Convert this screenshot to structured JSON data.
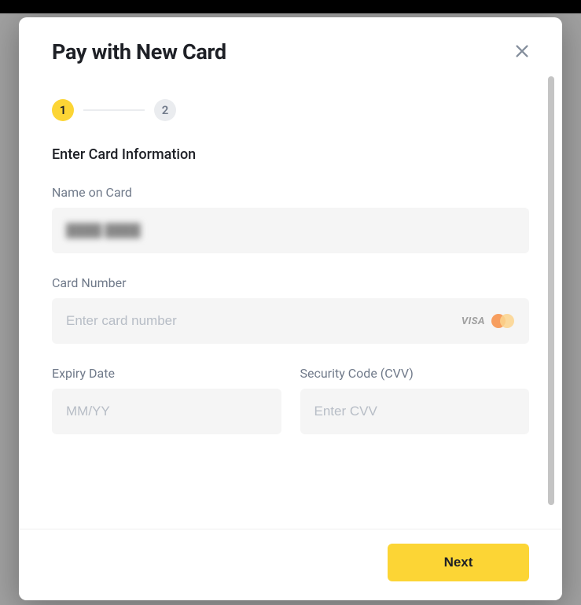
{
  "modal": {
    "title": "Pay with New Card",
    "section_title": "Enter Card Information",
    "next_button": "Next"
  },
  "stepper": {
    "step1": "1",
    "step2": "2"
  },
  "fields": {
    "name": {
      "label": "Name on Card",
      "blurred_value": "████ ████"
    },
    "card_number": {
      "label": "Card Number",
      "placeholder": "Enter card number",
      "visa_label": "VISA"
    },
    "expiry": {
      "label": "Expiry Date",
      "placeholder": "MM/YY"
    },
    "cvv": {
      "label": "Security Code (CVV)",
      "placeholder": "Enter CVV"
    }
  }
}
